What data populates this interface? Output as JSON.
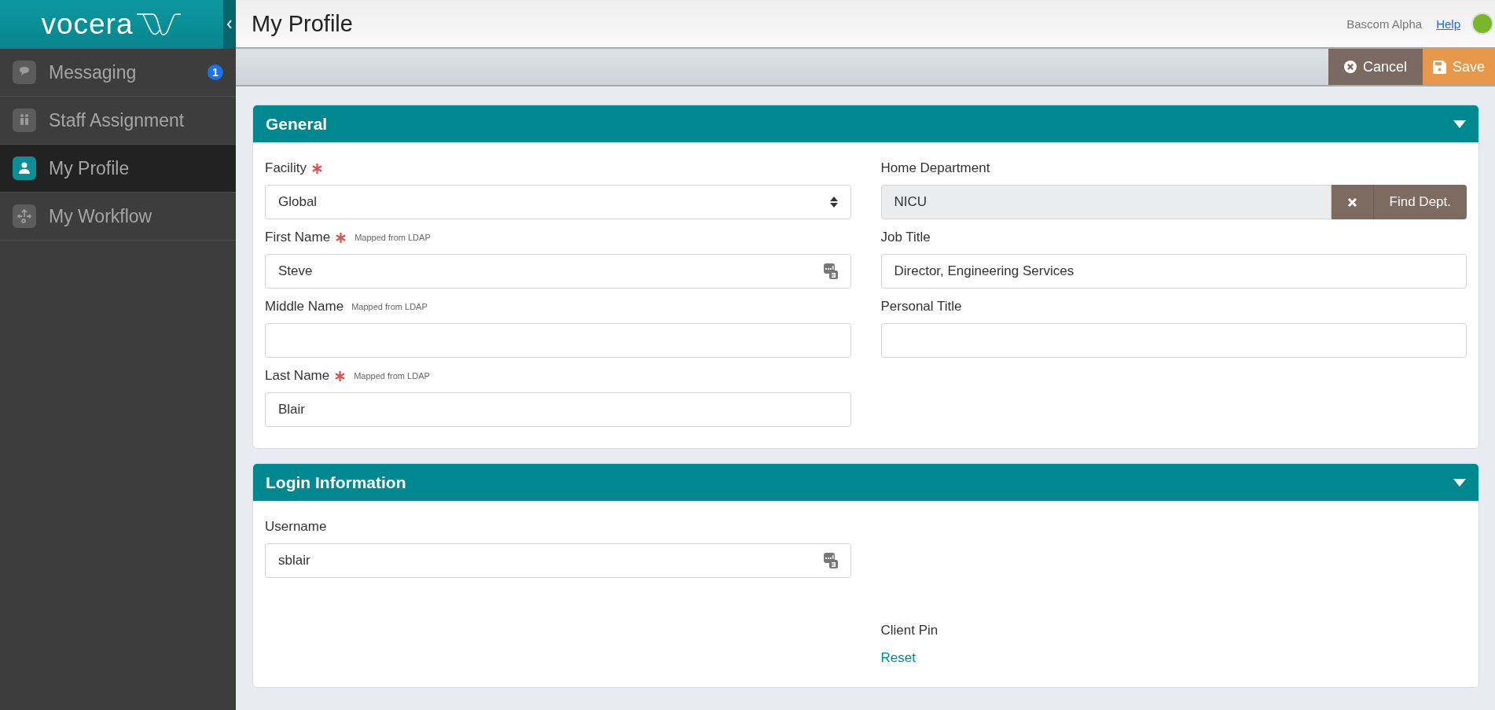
{
  "sidebar": {
    "logo": "vocera",
    "items": [
      {
        "label": "Messaging",
        "badge": "1",
        "selected": false
      },
      {
        "label": "Staff Assignment",
        "selected": false
      },
      {
        "label": "My Profile",
        "selected": true
      },
      {
        "label": "My Workflow",
        "selected": false
      }
    ]
  },
  "header": {
    "title": "My Profile",
    "user": "Bascom Alpha",
    "help": "Help"
  },
  "toolbar": {
    "buttons": [
      {
        "label": "Cancel",
        "kind": "cancel"
      },
      {
        "label": "Save",
        "kind": "save"
      }
    ]
  },
  "panels": [
    {
      "title": "General",
      "expanded": true,
      "columns": [
        [
          {
            "kind": "select",
            "label": "Facility",
            "required": true,
            "value": "Global"
          },
          {
            "kind": "text",
            "label": "First Name",
            "required": true,
            "note": "Mapped from LDAP",
            "value": "Steve",
            "key_icon": true
          },
          {
            "kind": "text",
            "label": "Middle Name",
            "required": false,
            "note": "Mapped from LDAP"
          },
          {
            "kind": "text",
            "label": "Last Name",
            "required": true,
            "note": "Mapped from LDAP",
            "value": "Blair"
          }
        ],
        [
          {
            "kind": "lookup",
            "label": "Home Department",
            "required": false,
            "value": "NICU",
            "button": "Find Dept."
          },
          {
            "kind": "text",
            "label": "Job Title",
            "required": false,
            "value": "Director, Engineering Services"
          },
          {
            "kind": "text",
            "label": "Personal Title",
            "required": false
          }
        ]
      ]
    },
    {
      "title": "Login Information",
      "expanded": true,
      "columns": [
        [
          {
            "kind": "text",
            "label": "Username",
            "required": false,
            "value": "sblair",
            "key_icon": true
          }
        ],
        [
          {
            "kind": "spacer"
          },
          {
            "kind": "link",
            "label": "Client Pin",
            "required": false,
            "link": "Reset"
          }
        ]
      ]
    }
  ]
}
